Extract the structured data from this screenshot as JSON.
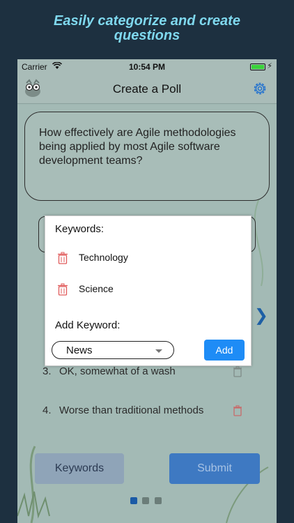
{
  "promo": {
    "line1": "Easily categorize and create",
    "line2": "questions"
  },
  "status_bar": {
    "carrier": "Carrier",
    "time": "10:54 PM",
    "icons": [
      "wifi-icon",
      "battery-icon",
      "charging-icon"
    ]
  },
  "nav": {
    "title": "Create a Poll",
    "left_icon": "app-logo-icon",
    "right_icon": "gear-icon"
  },
  "question": {
    "text": "How effectively are Agile methodologies being applied by most Agile software development teams?"
  },
  "answers": [
    {
      "num": "3.",
      "text": "OK, somewhat of a wash"
    },
    {
      "num": "4.",
      "text": "Worse than traditional methods"
    }
  ],
  "modal": {
    "heading": "Keywords:",
    "keywords": [
      "Technology",
      "Science"
    ],
    "add_label": "Add Keyword:",
    "select_value": "News",
    "add_button": "Add"
  },
  "footer": {
    "keywords_button": "Keywords",
    "submit_button": "Submit",
    "page_dots": 3,
    "active_dot": 1
  },
  "colors": {
    "page_bg": "#1d3040",
    "promo_text": "#7fd8ee",
    "accent": "#1e8cf6",
    "trash": "#e05a5a"
  }
}
